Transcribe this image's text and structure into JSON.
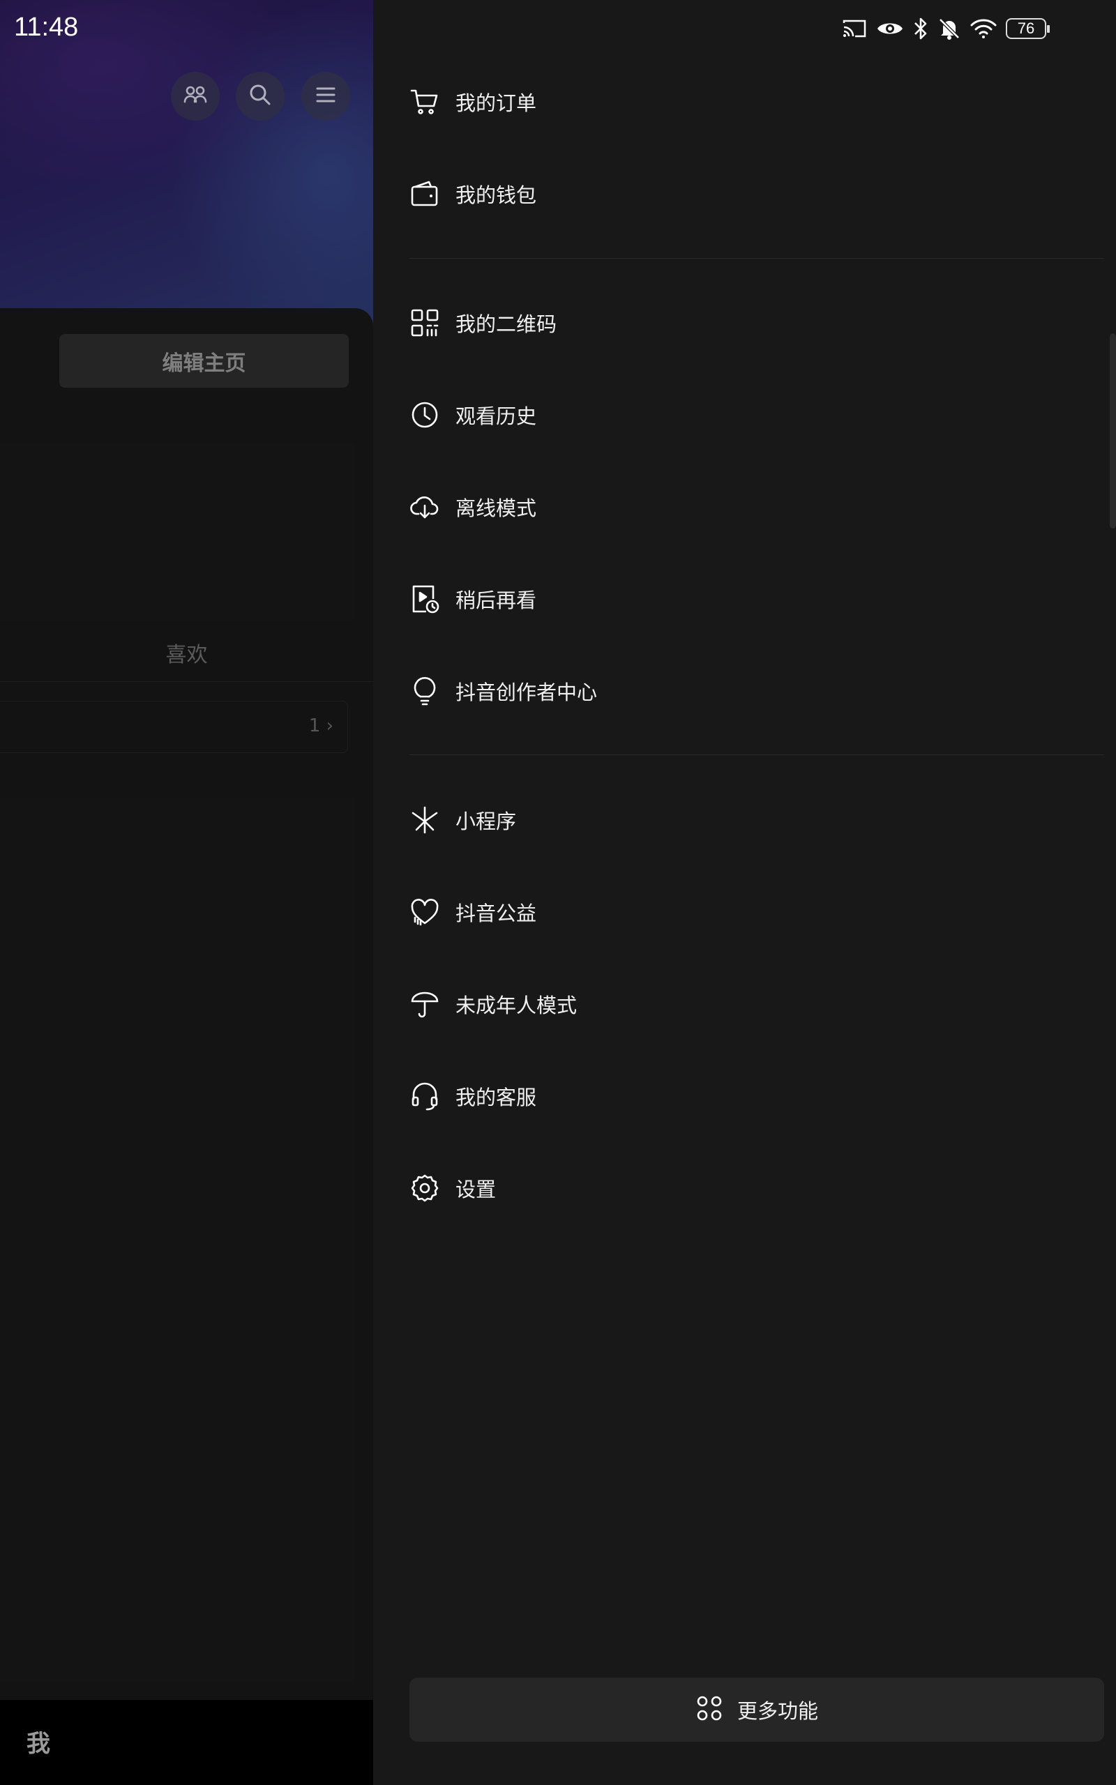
{
  "status_bar": {
    "time": "11:48",
    "battery": "76",
    "icons": [
      "cast-icon",
      "eye-icon",
      "bluetooth-icon",
      "mute-icon",
      "wifi-icon",
      "battery-icon"
    ]
  },
  "profile": {
    "top_icons": [
      "friends-icon",
      "search-icon",
      "menu-icon"
    ],
    "edit_button": "编辑主页",
    "likes_tab": "喜欢",
    "likes_count": "1 ›",
    "bottom_tab": "我"
  },
  "drawer": {
    "group1": [
      {
        "label": "我的订单",
        "icon": "cart-icon"
      },
      {
        "label": "我的钱包",
        "icon": "wallet-icon"
      }
    ],
    "group2": [
      {
        "label": "我的二维码",
        "icon": "qr-code-icon"
      },
      {
        "label": "观看历史",
        "icon": "clock-icon"
      },
      {
        "label": "离线模式",
        "icon": "cloud-download-icon"
      },
      {
        "label": "稍后再看",
        "icon": "watch-later-icon"
      },
      {
        "label": "抖音创作者中心",
        "icon": "lightbulb-icon"
      }
    ],
    "group3": [
      {
        "label": "小程序",
        "icon": "mini-program-icon"
      },
      {
        "label": "抖音公益",
        "icon": "charity-heart-icon"
      },
      {
        "label": "未成年人模式",
        "icon": "umbrella-icon"
      },
      {
        "label": "我的客服",
        "icon": "headset-icon"
      },
      {
        "label": "设置",
        "icon": "gear-icon"
      }
    ],
    "more_button": "更多功能"
  }
}
